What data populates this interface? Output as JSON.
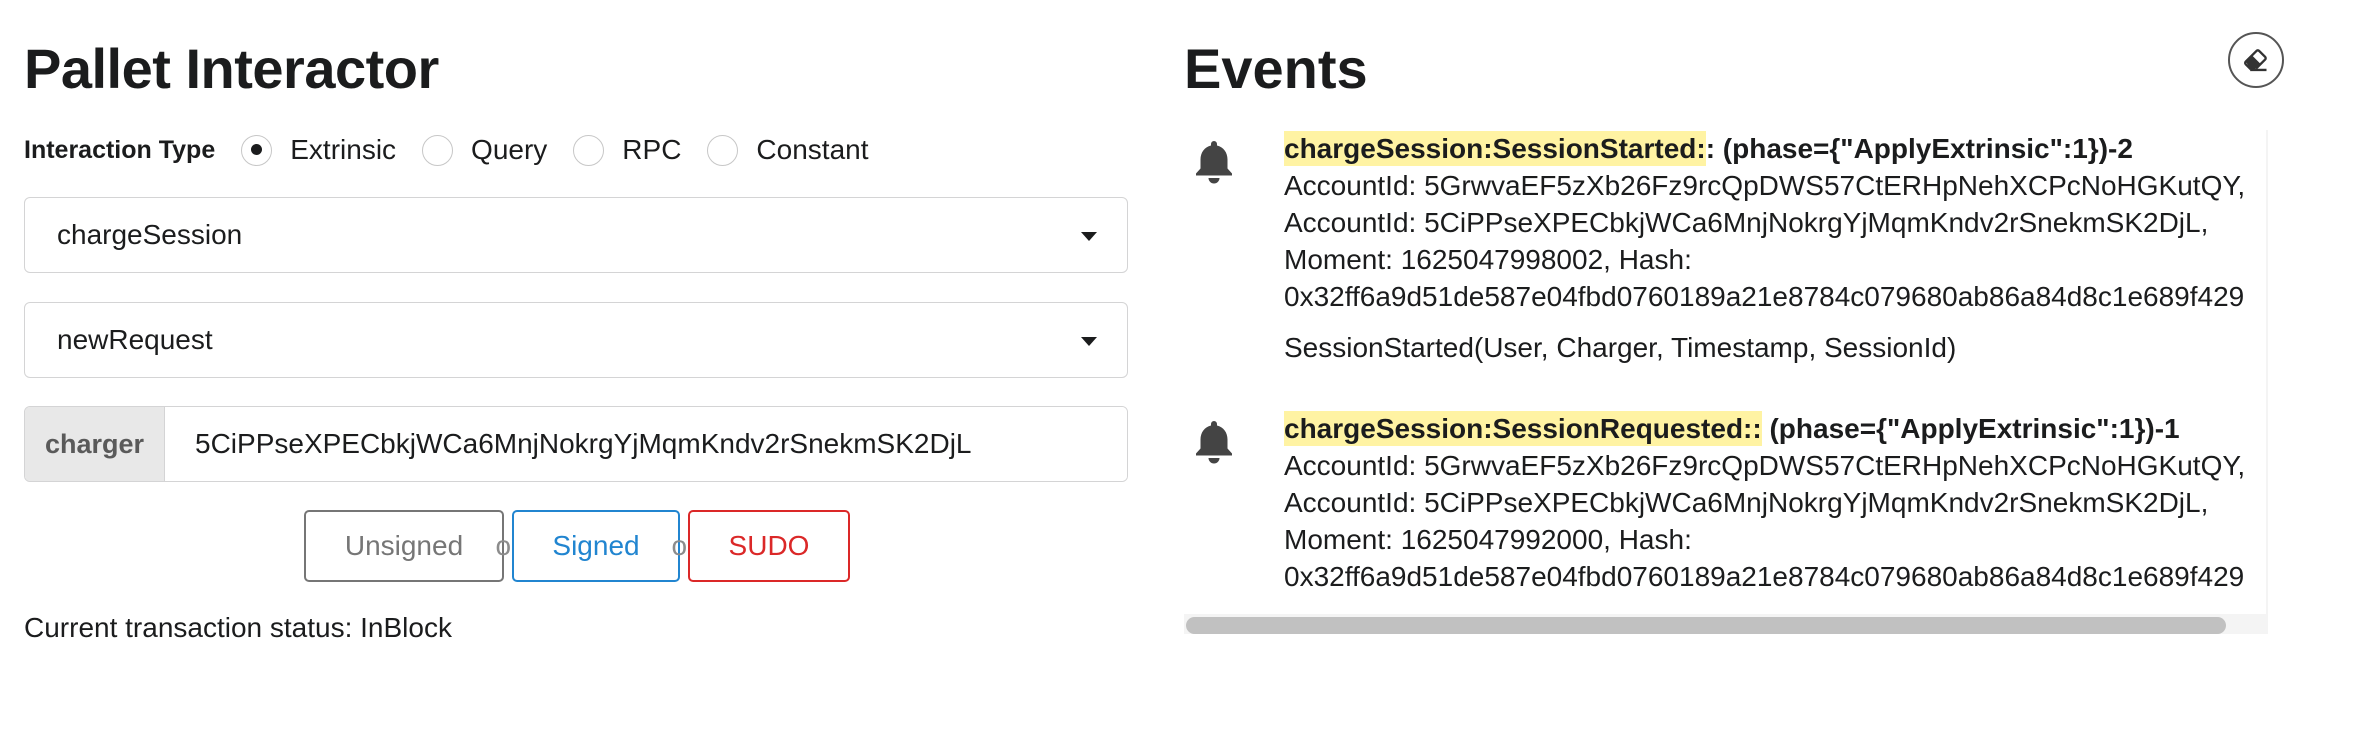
{
  "left": {
    "title": "Pallet Interactor",
    "interaction_type": {
      "label": "Interaction Type",
      "options": [
        {
          "label": "Extrinsic",
          "checked": true
        },
        {
          "label": "Query",
          "checked": false
        },
        {
          "label": "RPC",
          "checked": false
        },
        {
          "label": "Constant",
          "checked": false
        }
      ]
    },
    "pallet_dropdown": {
      "value": "chargeSession",
      "icon": "chevron-down-icon"
    },
    "callable_dropdown": {
      "value": "newRequest",
      "icon": "chevron-down-icon"
    },
    "param": {
      "label": "charger",
      "value": "5CiPPseXPECbkjWCa6MnjNokrgYjMqmKndv2rSnekmSK2DjL"
    },
    "buttons": {
      "unsigned": "Unsigned",
      "or1": "or",
      "signed": "Signed",
      "or2": "or",
      "sudo": "SUDO"
    },
    "status": "Current transaction status: InBlock"
  },
  "right": {
    "title": "Events",
    "clear_icon": "eraser-icon",
    "events": [
      {
        "icon": "bell-icon",
        "name": "chargeSession:SessionStarted:",
        "suffix": ": (phase={\"ApplyExtrinsic\":1})-2",
        "lines": [
          "AccountId: 5GrwvaEF5zXb26Fz9rcQpDWS57CtERHpNehXCPcNoHGKutQY,",
          "AccountId: 5CiPPseXPECbkjWCa6MnjNokrgYjMqmKndv2rSnekmSK2DjL,",
          "Moment: 1625047998002, Hash:",
          "0x32ff6a9d51de587e04fbd0760189a21e8784c079680ab86a84d8c1e689f429"
        ],
        "signature": "SessionStarted(User, Charger, Timestamp, SessionId)"
      },
      {
        "icon": "bell-icon",
        "name": "chargeSession:SessionRequested::",
        "suffix": " (phase={\"ApplyExtrinsic\":1})-1",
        "lines": [
          "AccountId: 5GrwvaEF5zXb26Fz9rcQpDWS57CtERHpNehXCPcNoHGKutQY,",
          "AccountId: 5CiPPseXPECbkjWCa6MnjNokrgYjMqmKndv2rSnekmSK2DjL,",
          "Moment: 1625047992000, Hash:",
          "0x32ff6a9d51de587e04fbd0760189a21e8784c079680ab86a84d8c1e689f429"
        ]
      }
    ]
  }
}
